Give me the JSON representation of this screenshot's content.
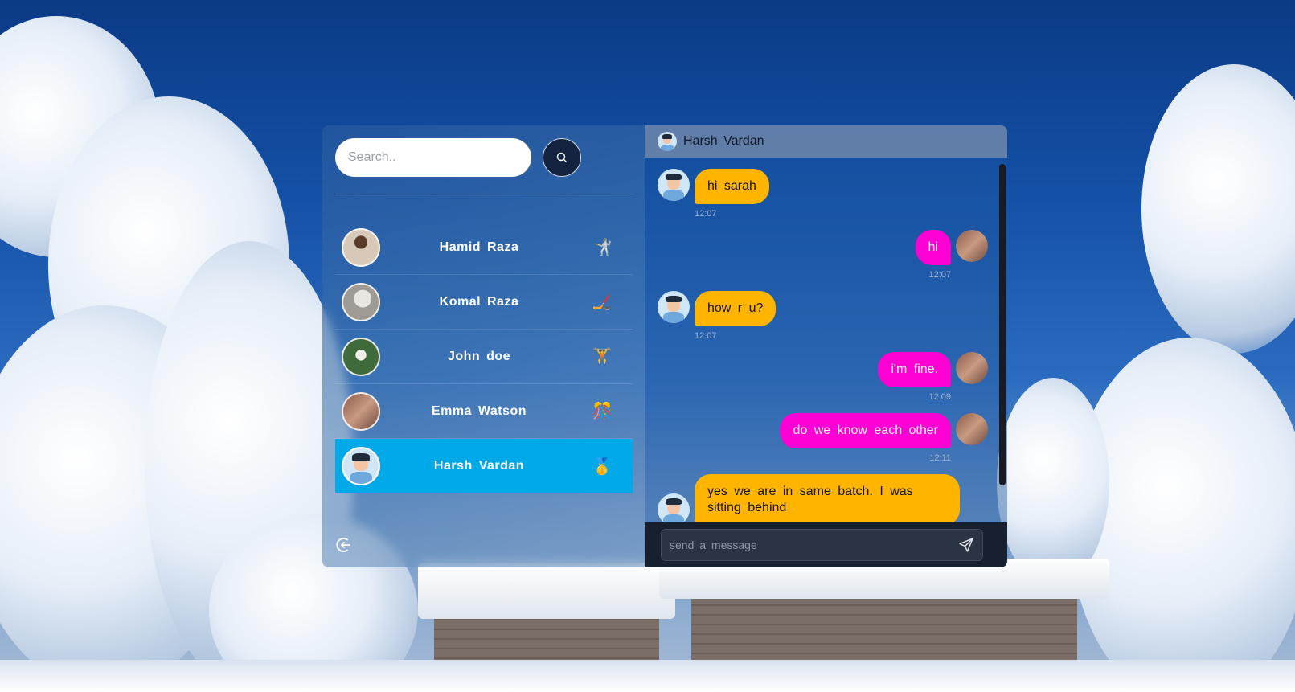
{
  "search": {
    "placeholder": "Search.."
  },
  "contacts": [
    {
      "name": "Hamid Raza",
      "emoji": "🤺"
    },
    {
      "name": "Komal Raza",
      "emoji": "🏒"
    },
    {
      "name": "John doe",
      "emoji": "🏋"
    },
    {
      "name": "Emma Watson",
      "emoji": "🎊"
    },
    {
      "name": "Harsh Vardan",
      "emoji": "🥇",
      "active": true
    }
  ],
  "chat": {
    "header_name": "Harsh Vardan",
    "messages": [
      {
        "dir": "in",
        "text": "hi sarah",
        "time": "12:07"
      },
      {
        "dir": "out",
        "text": "hi",
        "time": "12:07"
      },
      {
        "dir": "in",
        "text": "how r u?",
        "time": "12:07"
      },
      {
        "dir": "out",
        "text": "i'm fine.",
        "time": "12:09"
      },
      {
        "dir": "out",
        "text": "do we know each other",
        "time": "12:11"
      },
      {
        "dir": "in",
        "text": "yes we are in same batch. I was sitting behind",
        "time": ""
      }
    ],
    "input_placeholder": "send a message"
  },
  "colors": {
    "incoming_bubble": "#ffb400",
    "outgoing_bubble": "#ff00d4",
    "active_contact": "#02a9e8"
  }
}
